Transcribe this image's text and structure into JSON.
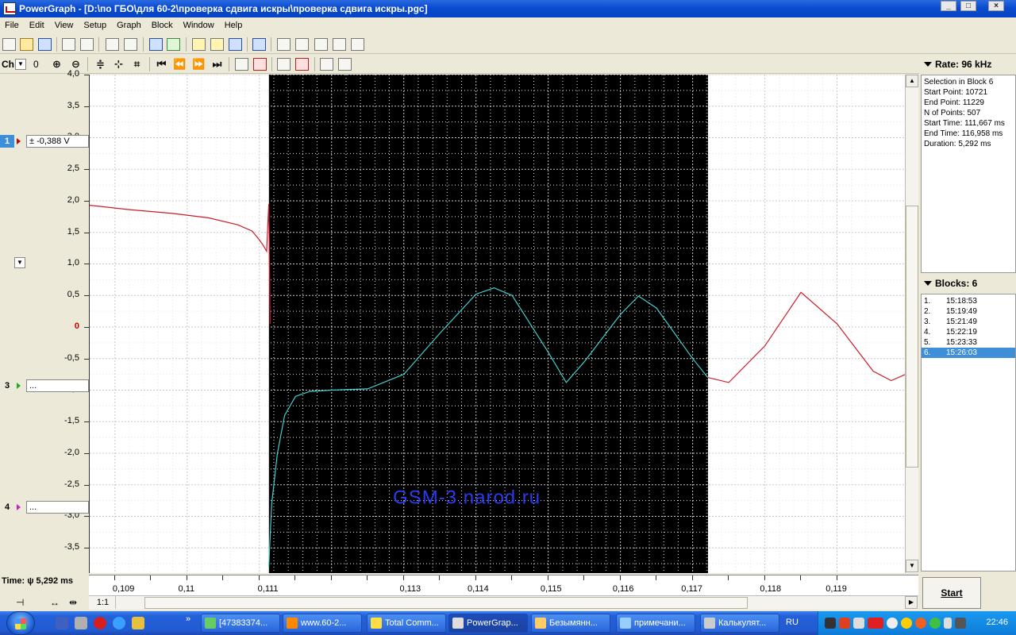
{
  "window": {
    "title": "PowerGraph - [D:\\по ГБО\\для 60-2\\проверка сдвига искры\\проверка сдвига искры.pgc]",
    "btn_minimize": "_",
    "btn_restore": "□",
    "btn_close": "×"
  },
  "menu": [
    "File",
    "Edit",
    "View",
    "Setup",
    "Graph",
    "Block",
    "Window",
    "Help"
  ],
  "toolbar2": {
    "channel_label": "Ch",
    "channel_value": "0"
  },
  "channels": {
    "ch1": {
      "num": "1",
      "value": "± -0,388 V"
    },
    "ch3": {
      "num": "3",
      "value": "..."
    },
    "ch4": {
      "num": "4",
      "value": "..."
    }
  },
  "y_axis": {
    "labels": [
      "4,0",
      "3,5",
      "3,0",
      "2,5",
      "2,0",
      "1,5",
      "1,0",
      "0,5",
      "0",
      "-0,5",
      "-1,0",
      "-1,5",
      "-2,0",
      "-2,5",
      "-3,0",
      "-3,5"
    ],
    "range": [
      -3.9,
      4.0
    ]
  },
  "x_axis": {
    "labels": [
      "0,109",
      "0,11",
      "0,111",
      "0,113",
      "0,114",
      "0,115",
      "0,116",
      "0,117",
      "0,118",
      "0,119"
    ],
    "range": [
      0.10865,
      0.11995
    ]
  },
  "selection": {
    "x_start": 0.111132,
    "x_end": 0.117213
  },
  "watermark": "GSM-3.narod.ru",
  "rate": {
    "label": "Rate: 96 kHz"
  },
  "selection_info": {
    "lines": [
      "Selection in Block 6",
      "Start Point: 10721",
      "End Point: 11229",
      "N of Points: 507",
      "Start Time: 111,667 ms",
      "End Time: 116,958 ms",
      "Duration: 5,292 ms"
    ]
  },
  "blocks": {
    "header": "Blocks: 6",
    "items": [
      {
        "n": "1.",
        "time": "15:18:53"
      },
      {
        "n": "2.",
        "time": "15:19:49"
      },
      {
        "n": "3.",
        "time": "15:21:49"
      },
      {
        "n": "4.",
        "time": "15:22:19"
      },
      {
        "n": "5.",
        "time": "15:23:33"
      },
      {
        "n": "6.",
        "time": "15:26:03"
      }
    ],
    "selected_index": 5
  },
  "time_label": "Time: ψ 5,292 ms",
  "zoom_label": "1:1",
  "start_button": "Start",
  "taskbar": {
    "tasks": [
      {
        "label": "[47383374...",
        "icon": "#6c6"
      },
      {
        "label": "www.60-2...",
        "icon": "#f80"
      },
      {
        "label": "Total Comm...",
        "icon": "#fd4"
      },
      {
        "label": "PowerGrap...",
        "icon": "#ddd"
      },
      {
        "label": "Безымянн...",
        "icon": "#fc6"
      },
      {
        "label": "примечани...",
        "icon": "#9cf"
      },
      {
        "label": "Калькулят...",
        "icon": "#ccc"
      }
    ],
    "language": "RU",
    "clock": "22:46"
  },
  "colors": {
    "signal_red": "#cc1a2a",
    "signal_cyan": "#40d0d0",
    "selection_bg": "#000000",
    "watermark": "#2a3cf0",
    "grid": "#c8c8c8"
  },
  "chart_data": {
    "type": "line",
    "xlabel": "",
    "ylabel": "",
    "xlim": [
      0.10865,
      0.11995
    ],
    "ylim": [
      -3.9,
      4.0
    ],
    "grid": true,
    "series": [
      {
        "color": "#cc1a2a",
        "x": [
          0.10865,
          0.1092,
          0.1098,
          0.1103,
          0.1107,
          0.1109,
          0.111,
          0.11105,
          0.1111,
          0.11113,
          0.11115
        ],
        "y": [
          1.93,
          1.86,
          1.8,
          1.73,
          1.62,
          1.52,
          1.38,
          1.3,
          1.2,
          1.95,
          0.05
        ]
      },
      {
        "color": "#40d0d0",
        "x": [
          0.11113,
          0.11117,
          0.11125,
          0.11135,
          0.1115,
          0.1117,
          0.112,
          0.1125,
          0.113,
          0.1135,
          0.114,
          0.11425,
          0.1145,
          0.115,
          0.11525,
          0.1155,
          0.116,
          0.11625,
          0.1165,
          0.117,
          0.11721
        ],
        "y": [
          -3.8,
          -2.8,
          -2.0,
          -1.4,
          -1.1,
          -1.02,
          -1.0,
          -0.98,
          -0.75,
          -0.1,
          0.52,
          0.62,
          0.5,
          -0.4,
          -0.88,
          -0.55,
          0.2,
          0.49,
          0.3,
          -0.5,
          -0.8
        ]
      },
      {
        "color": "#cc1a2a",
        "x": [
          0.11721,
          0.1175,
          0.118,
          0.1185,
          0.119,
          0.1195,
          0.11975,
          0.11995
        ],
        "y": [
          -0.8,
          -0.88,
          -0.3,
          0.55,
          0.05,
          -0.7,
          -0.85,
          -0.75
        ]
      }
    ]
  }
}
